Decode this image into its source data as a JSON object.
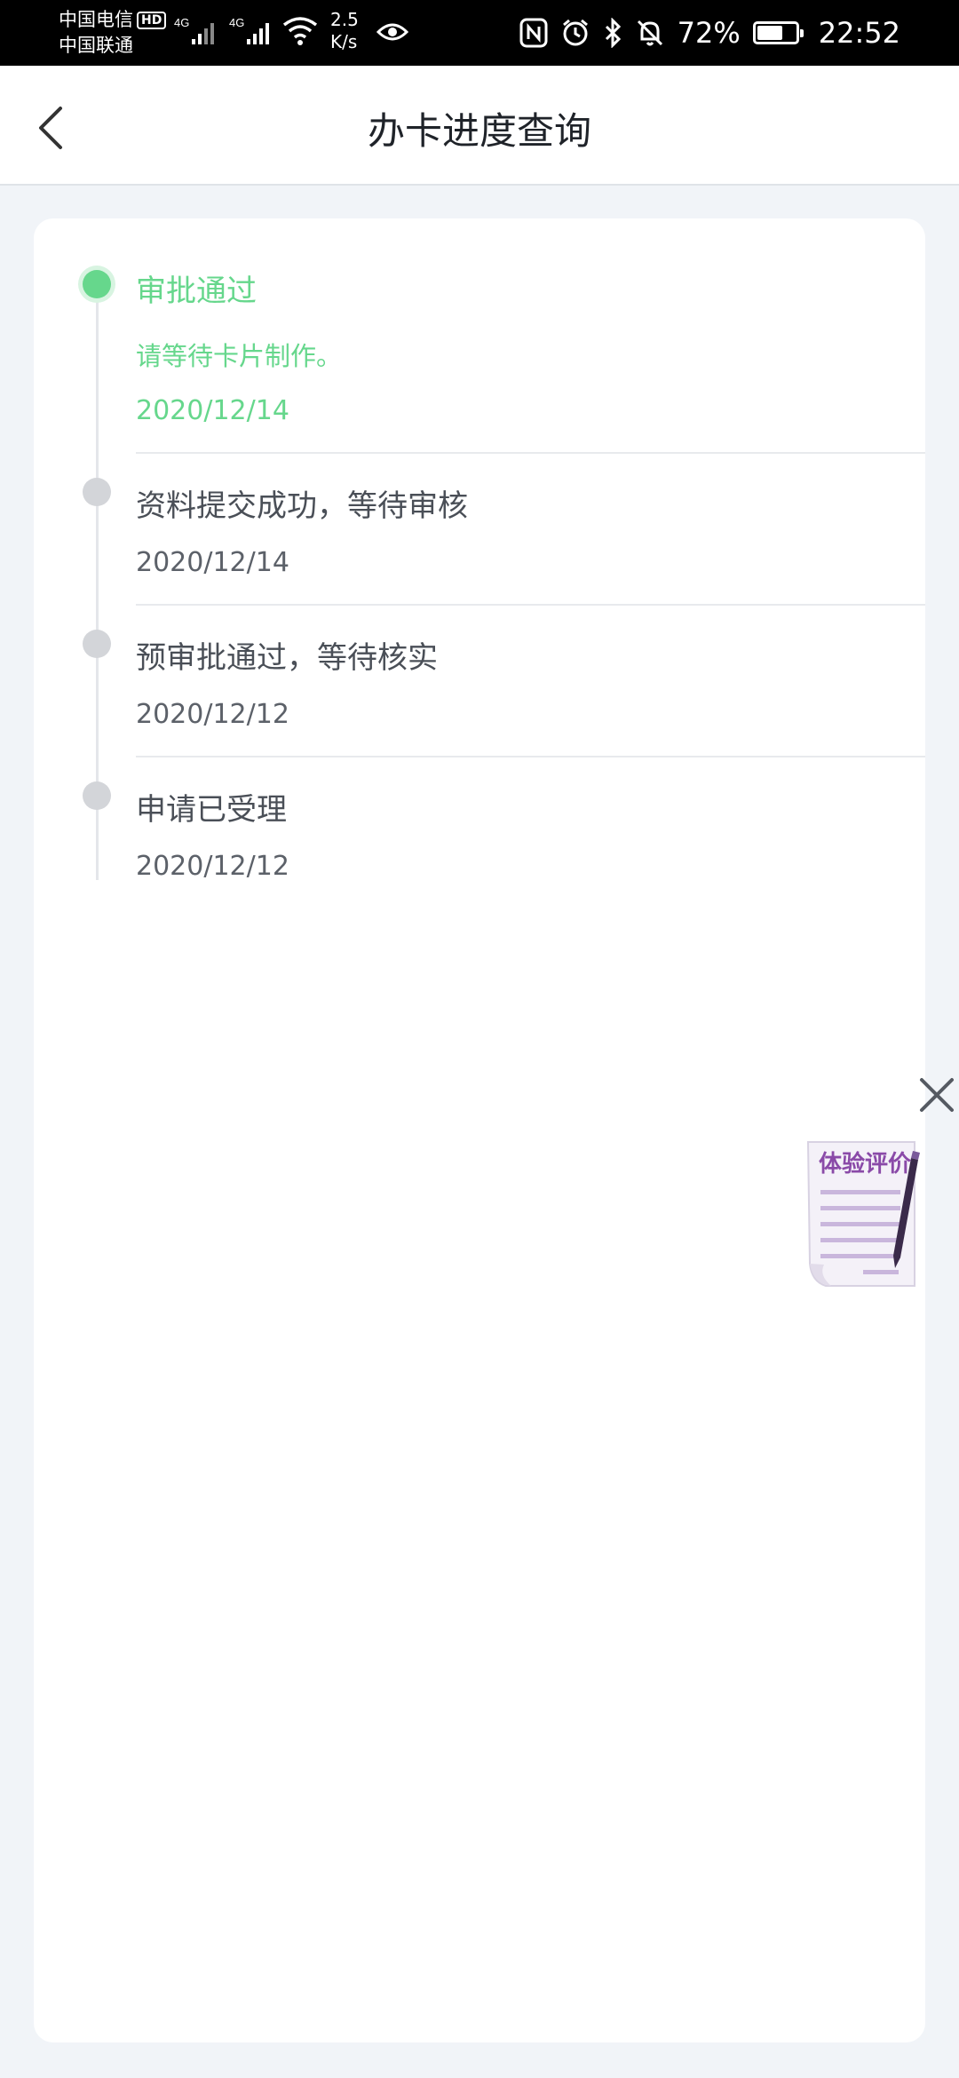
{
  "status_bar": {
    "carrier_1": "中国电信",
    "carrier_1_badge": "HD",
    "carrier_2": "中国联通",
    "network_1": "4G",
    "network_2": "4G",
    "speed_value": "2.5",
    "speed_unit": "K/s",
    "battery_percent": "72%",
    "battery_level": 0.72,
    "time": "22:52",
    "icons": [
      "signal-icon",
      "wifi-icon",
      "eye-icon",
      "nfc-icon",
      "alarm-icon",
      "bluetooth-icon",
      "mute-bell-icon",
      "battery-icon"
    ]
  },
  "header": {
    "title": "办卡进度查询",
    "back_icon": "chevron-left-icon"
  },
  "timeline": {
    "steps": [
      {
        "title": "审批通过",
        "subtitle": "请等待卡片制作。",
        "date": "2020/12/14",
        "active": true
      },
      {
        "title": "资料提交成功，等待审核",
        "date": "2020/12/14",
        "active": false
      },
      {
        "title": "预审批通过，等待核实",
        "date": "2020/12/12",
        "active": false
      },
      {
        "title": "申请已受理",
        "date": "2020/12/12",
        "active": false
      }
    ]
  },
  "feedback_widget": {
    "label": "体验评价",
    "close_icon": "close-icon",
    "accent": "#8a4aa8"
  },
  "colors": {
    "active_green": "#66d78c",
    "inactive_dot": "#d3d5d9",
    "page_bg": "#f1f4f8"
  }
}
